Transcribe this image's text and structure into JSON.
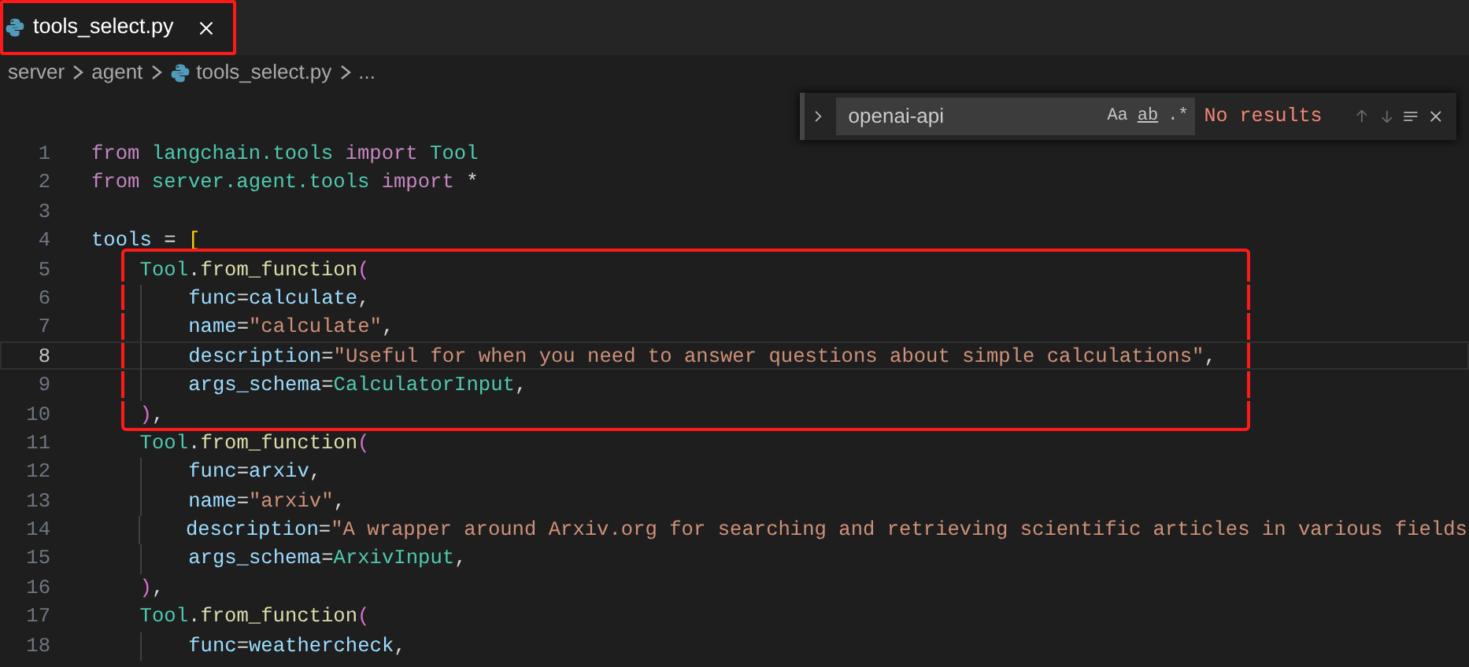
{
  "tab": {
    "title": "tools_select.py",
    "active": true,
    "annotated": true
  },
  "breadcrumb": [
    {
      "kind": "folder",
      "label": "server"
    },
    {
      "kind": "folder",
      "label": "agent"
    },
    {
      "kind": "file",
      "label": "tools_select.py"
    },
    {
      "kind": "more",
      "label": "..."
    }
  ],
  "find": {
    "value": "openai-api",
    "options": [
      "Aa",
      "ab",
      ".*"
    ],
    "result": "No results"
  },
  "lines": [
    {
      "number": "1",
      "kind": "statement",
      "current": false,
      "annotated": false,
      "tokens": [
        {
          "kind": "kw",
          "text": "from "
        },
        {
          "kind": "ns",
          "text": "langchain.tools "
        },
        {
          "kind": "kw",
          "text": "import "
        },
        {
          "kind": "ns",
          "text": "Tool"
        }
      ]
    },
    {
      "number": "2",
      "kind": "statement",
      "current": false,
      "annotated": false,
      "tokens": [
        {
          "kind": "kw",
          "text": "from "
        },
        {
          "kind": "ns",
          "text": "server.agent.tools "
        },
        {
          "kind": "kw",
          "text": "import "
        },
        {
          "kind": "op",
          "text": "*"
        }
      ]
    },
    {
      "number": "3",
      "kind": "statement",
      "current": false,
      "annotated": false
    },
    {
      "number": "4",
      "kind": "statement",
      "current": false,
      "annotated": false,
      "tokens": [
        {
          "kind": "var",
          "text": "tools "
        },
        {
          "kind": "op",
          "text": "= "
        },
        {
          "kind": "br1",
          "text": "["
        }
      ]
    },
    {
      "number": "5",
      "kind": "call",
      "current": false,
      "annotated": true,
      "tokens": [
        {
          "kind": "ns",
          "text": "Tool"
        },
        {
          "kind": "op",
          "text": "."
        },
        {
          "kind": "fn",
          "text": "from_function"
        },
        {
          "kind": "br2",
          "text": "("
        }
      ]
    },
    {
      "number": "6",
      "kind": "argument",
      "current": false,
      "annotated": true,
      "tokens": [
        {
          "kind": "var",
          "text": "func"
        },
        {
          "kind": "op",
          "text": "="
        },
        {
          "kind": "var",
          "text": "calculate"
        },
        {
          "kind": "op",
          "text": ","
        }
      ]
    },
    {
      "number": "7",
      "kind": "argument",
      "current": false,
      "annotated": true,
      "tokens": [
        {
          "kind": "var",
          "text": "name"
        },
        {
          "kind": "op",
          "text": "="
        },
        {
          "kind": "str",
          "text": "\"calculate\""
        },
        {
          "kind": "op",
          "text": ","
        }
      ]
    },
    {
      "number": "8",
      "kind": "argument",
      "current": true,
      "annotated": true,
      "tokens": [
        {
          "kind": "var",
          "text": "description"
        },
        {
          "kind": "op",
          "text": "="
        },
        {
          "kind": "str",
          "text": "\"Useful for when you need to answer questions about simple calculations\""
        },
        {
          "kind": "op",
          "text": ","
        }
      ]
    },
    {
      "number": "9",
      "kind": "argument",
      "current": false,
      "annotated": true,
      "tokens": [
        {
          "kind": "var",
          "text": "args_schema"
        },
        {
          "kind": "op",
          "text": "="
        },
        {
          "kind": "ns",
          "text": "CalculatorInput"
        },
        {
          "kind": "op",
          "text": ","
        }
      ]
    },
    {
      "number": "10",
      "kind": "call",
      "current": false,
      "annotated": true,
      "tokens": [
        {
          "kind": "br2",
          "text": ")"
        },
        {
          "kind": "op",
          "text": ","
        }
      ]
    },
    {
      "number": "11",
      "kind": "call",
      "current": false,
      "annotated": false,
      "tokens": [
        {
          "kind": "ns",
          "text": "Tool"
        },
        {
          "kind": "op",
          "text": "."
        },
        {
          "kind": "fn",
          "text": "from_function"
        },
        {
          "kind": "br2",
          "text": "("
        }
      ]
    },
    {
      "number": "12",
      "kind": "argument",
      "current": false,
      "annotated": false,
      "tokens": [
        {
          "kind": "var",
          "text": "func"
        },
        {
          "kind": "op",
          "text": "="
        },
        {
          "kind": "var",
          "text": "arxiv"
        },
        {
          "kind": "op",
          "text": ","
        }
      ]
    },
    {
      "number": "13",
      "kind": "argument",
      "current": false,
      "annotated": false,
      "tokens": [
        {
          "kind": "var",
          "text": "name"
        },
        {
          "kind": "op",
          "text": "="
        },
        {
          "kind": "str",
          "text": "\"arxiv\""
        },
        {
          "kind": "op",
          "text": ","
        }
      ]
    },
    {
      "number": "14",
      "kind": "argument",
      "current": false,
      "annotated": false,
      "tokens": [
        {
          "kind": "var",
          "text": "description"
        },
        {
          "kind": "op",
          "text": "="
        },
        {
          "kind": "str",
          "text": "\"A wrapper around Arxiv.org for searching and retrieving scientific articles in various fields"
        }
      ]
    },
    {
      "number": "15",
      "kind": "argument",
      "current": false,
      "annotated": false,
      "tokens": [
        {
          "kind": "var",
          "text": "args_schema"
        },
        {
          "kind": "op",
          "text": "="
        },
        {
          "kind": "ns",
          "text": "ArxivInput"
        },
        {
          "kind": "op",
          "text": ","
        }
      ]
    },
    {
      "number": "16",
      "kind": "call",
      "current": false,
      "annotated": false,
      "tokens": [
        {
          "kind": "br2",
          "text": ")"
        },
        {
          "kind": "op",
          "text": ","
        }
      ]
    },
    {
      "number": "17",
      "kind": "call",
      "current": false,
      "annotated": false,
      "tokens": [
        {
          "kind": "ns",
          "text": "Tool"
        },
        {
          "kind": "op",
          "text": "."
        },
        {
          "kind": "fn",
          "text": "from_function"
        },
        {
          "kind": "br2",
          "text": "("
        }
      ]
    },
    {
      "number": "18",
      "kind": "argument",
      "current": false,
      "annotated": false,
      "tokens": [
        {
          "kind": "var",
          "text": "func"
        },
        {
          "kind": "op",
          "text": "="
        },
        {
          "kind": "var",
          "text": "weathercheck"
        },
        {
          "kind": "op",
          "text": ","
        }
      ]
    }
  ]
}
